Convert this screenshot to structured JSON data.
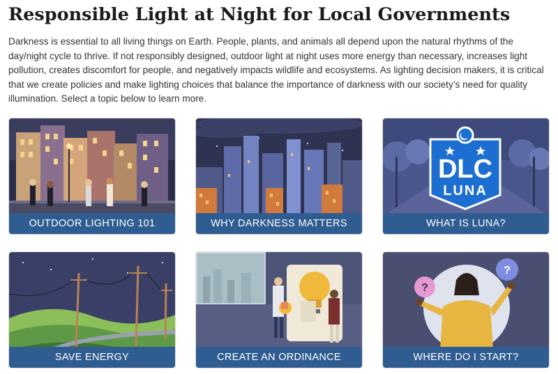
{
  "page": {
    "title": "Responsible Light at Night for Local Governments",
    "intro": "Darkness is essential to all living things on Earth. People, plants, and animals all depend upon the natural rhythms of the day/night cycle to thrive. If not responsibly designed, outdoor light at night uses more energy than necessary, increases light pollution, creates discomfort for people, and negatively impacts wildlife and ecosystems. As lighting decision makers, it is critical that we create policies and make lighting choices that balance the importance of darkness with our society’s need for quality illumination. Select a topic below to learn more."
  },
  "cards": [
    {
      "label": "OUTDOOR LIGHTING 101",
      "icon": "night-street-illustration"
    },
    {
      "label": "WHY DARKNESS MATTERS",
      "icon": "night-city-skyline-illustration"
    },
    {
      "label": "WHAT IS LUNA?",
      "icon": "dlc-luna-logo",
      "logo_top": "DLC",
      "logo_bottom": "LUNA"
    },
    {
      "label": "SAVE ENERGY",
      "icon": "power-lines-illustration"
    },
    {
      "label": "CREATE AN ORDINANCE",
      "icon": "puzzle-lightbulb-illustration"
    },
    {
      "label": "WHERE DO I START?",
      "icon": "person-question-illustration",
      "bubble_text": "?"
    }
  ],
  "colors": {
    "label_bar": "#2f5c91",
    "night_sky": "#2e3352",
    "logo_blue": "#1c6fd1"
  }
}
